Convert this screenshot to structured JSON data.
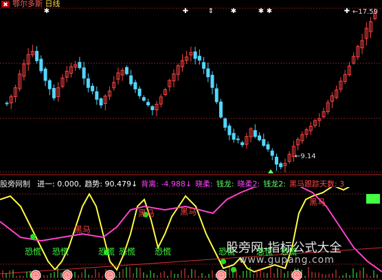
{
  "header": {
    "stock_name": "鄂尔多斯",
    "period": "日线"
  },
  "price_labels": {
    "high": "17.59",
    "low": "9.14"
  },
  "indicator_bar": {
    "name": "股旁网制",
    "items": [
      {
        "label": "进一: 0.000,",
        "color": "#ffffff"
      },
      {
        "label": "趋势: 90.479↓",
        "color": "#ffffff"
      },
      {
        "label": "背离: -4.988↓",
        "color": "#ff44ff"
      },
      {
        "label": "晓柔:",
        "color": "#ff44ff"
      },
      {
        "label": "钱龙:",
        "color": "#66ff66"
      },
      {
        "label": "晓柔2:",
        "color": "#ff44ff"
      },
      {
        "label": "钱龙2:",
        "color": "#66ff66"
      },
      {
        "label": "黑马跟踪天数: 3",
        "color": "#ff4444"
      }
    ]
  },
  "signals": {
    "top_star": "✱",
    "top_cross": "✚",
    "top_updown": "⇕",
    "panic": "恐慌",
    "heima": "黑马",
    "smile": "☺"
  },
  "watermark": {
    "line1": "股旁网-指标公式大全",
    "line2": "www.gupang.com"
  },
  "colors": {
    "up": "#ff4444",
    "down": "#54d6ff",
    "zigzag": "#ffff44",
    "trend": "#ff44cc",
    "panic": "#44ff44"
  }
}
